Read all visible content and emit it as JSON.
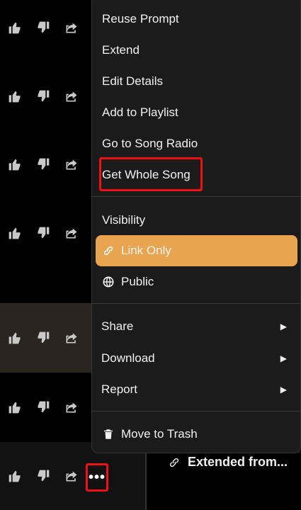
{
  "menu": {
    "items": [
      {
        "label": "Reuse Prompt"
      },
      {
        "label": "Extend"
      },
      {
        "label": "Edit Details"
      },
      {
        "label": "Add to Playlist"
      },
      {
        "label": "Go to Song Radio"
      },
      {
        "label": "Get Whole Song"
      }
    ],
    "visibility_label": "Visibility",
    "visibility_options": [
      {
        "label": "Link Only",
        "icon": "link-icon",
        "selected": true
      },
      {
        "label": "Public",
        "icon": "globe-icon",
        "selected": false
      }
    ],
    "submenus": [
      {
        "label": "Share"
      },
      {
        "label": "Download"
      },
      {
        "label": "Report"
      }
    ],
    "trash_label": "Move to Trash"
  },
  "extended_label": "Extended from...",
  "more_button_label": "•••",
  "colors": {
    "menu_bg": "#1b1b1b",
    "selected_bg": "#e9a44f",
    "annotation": "#e11111"
  }
}
